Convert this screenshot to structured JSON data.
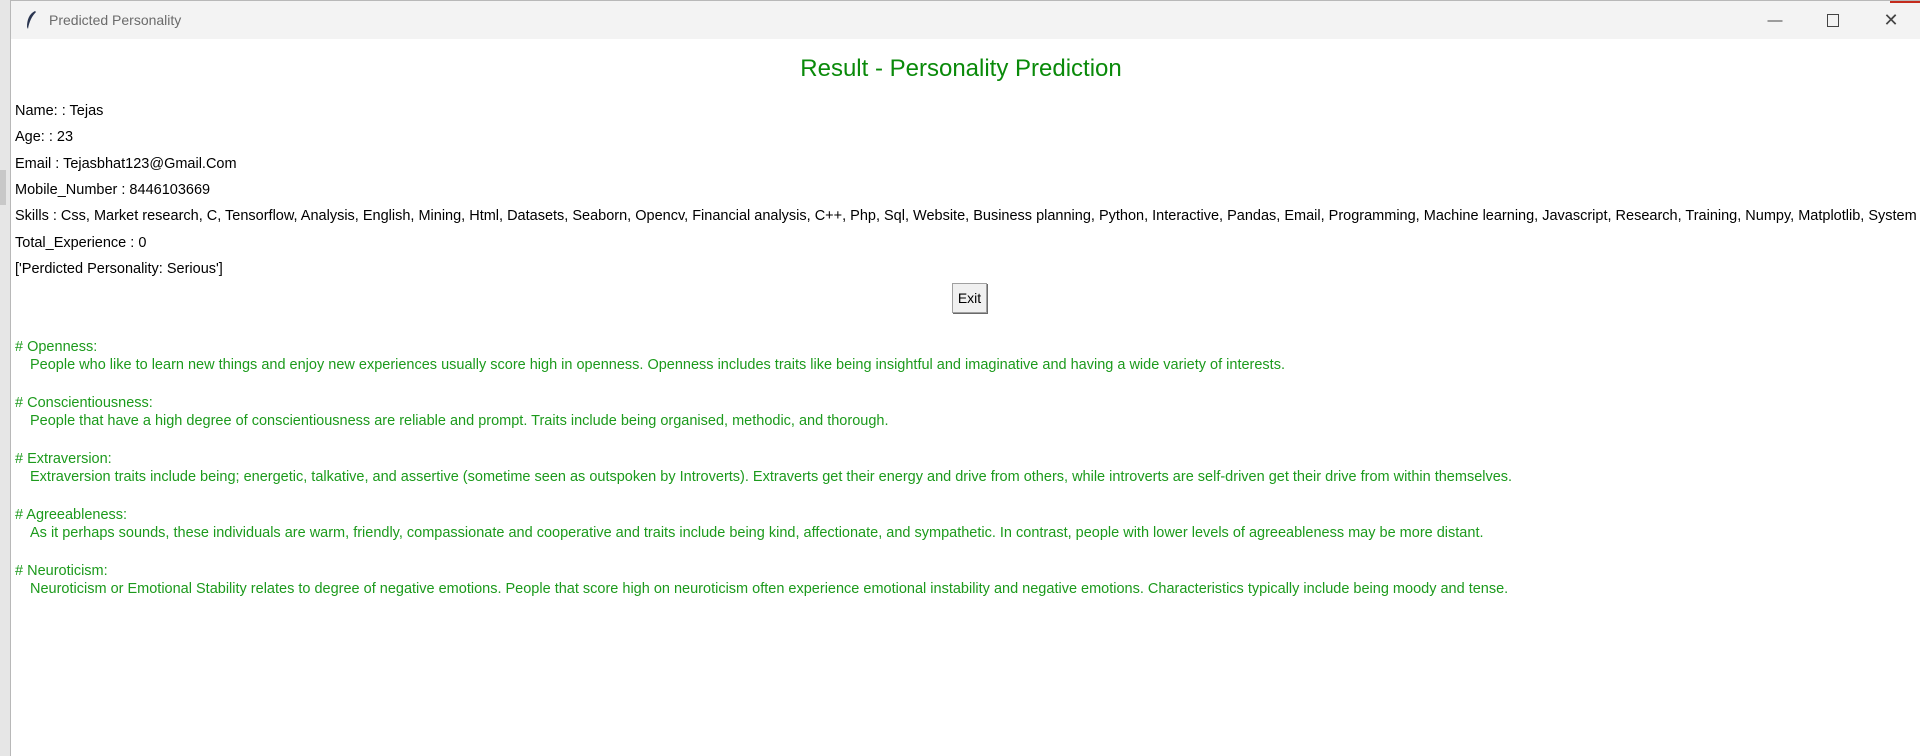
{
  "window": {
    "title": "Predicted Personality"
  },
  "heading": "Result - Personality Prediction",
  "info": [
    "Name: : Tejas",
    "Age: : 23",
    "Email : Tejasbhat123@Gmail.Com",
    "Mobile_Number : 8446103669",
    "Skills : Css, Market research, C, Tensorflow, Analysis, English, Mining, Html, Datasets, Seaborn, Opencv, Financial analysis, C++, Php, Sql, Website, Business planning, Python, Interactive, Pandas, Email, Programming, Machine learning, Javascript, Research, Training, Numpy, Matplotlib, System",
    "Total_Experience : 0",
    "['Perdicted Personality: Serious']"
  ],
  "exit_label": "Exit",
  "traits": [
    {
      "title": "# Openness:",
      "desc": "People who like to learn new things and enjoy new experiences usually score high in openness. Openness includes traits like being insightful and imaginative and having a wide variety of interests."
    },
    {
      "title": "# Conscientiousness:",
      "desc": "People that have a high degree of conscientiousness are reliable and prompt. Traits include being organised, methodic, and thorough."
    },
    {
      "title": "# Extraversion:",
      "desc": "Extraversion traits include being; energetic, talkative, and assertive (sometime seen as outspoken by Introverts). Extraverts get their energy and drive from others, while introverts are self-driven get their drive from within themselves."
    },
    {
      "title": "# Agreeableness:",
      "desc": "As it perhaps sounds, these individuals are warm, friendly, compassionate and cooperative and traits include being kind, affectionate, and sympathetic. In contrast, people with lower levels of agreeableness may be more distant."
    },
    {
      "title": "# Neuroticism:",
      "desc": "Neuroticism or Emotional Stability relates to degree of negative emotions. People that score high on neuroticism often experience emotional instability and negative emotions. Characteristics typically include being moody and tense."
    }
  ],
  "colors": {
    "accent": "#0a8a0a",
    "trait_text": "#1c9a1c"
  }
}
